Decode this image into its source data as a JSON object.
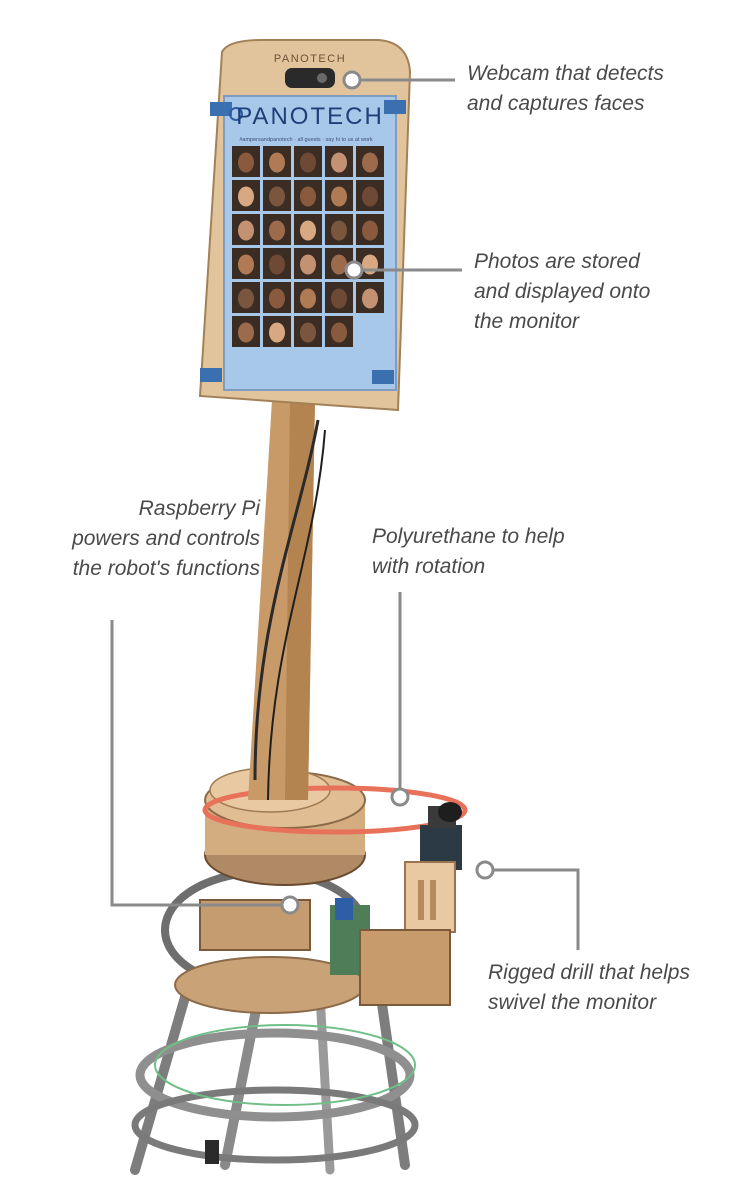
{
  "monitor": {
    "brand_frame": "PANOTECH",
    "screen_title": "PANOTECH",
    "screen_subtitle": "#ampersandpanotech  ·  all guests  ·  say hi to us at work"
  },
  "callouts": {
    "webcam": [
      "Webcam that detects",
      "and captures faces"
    ],
    "photos": [
      "Photos are stored",
      "and displayed onto",
      "the monitor"
    ],
    "raspberry": [
      "Raspberry Pi",
      "powers and controls",
      "the robot's functions"
    ],
    "polyurethane": [
      "Polyurethane to help",
      "with rotation"
    ],
    "drill": [
      "Rigged drill that helps",
      "swivel the monitor"
    ]
  },
  "colors": {
    "wood": "#d9b48a",
    "screen": "#a8c8ea",
    "tape": "#3a6fb0",
    "belt": "#e8715a",
    "leader_line": "#8a8a8a",
    "text": "#4a4a4a"
  }
}
